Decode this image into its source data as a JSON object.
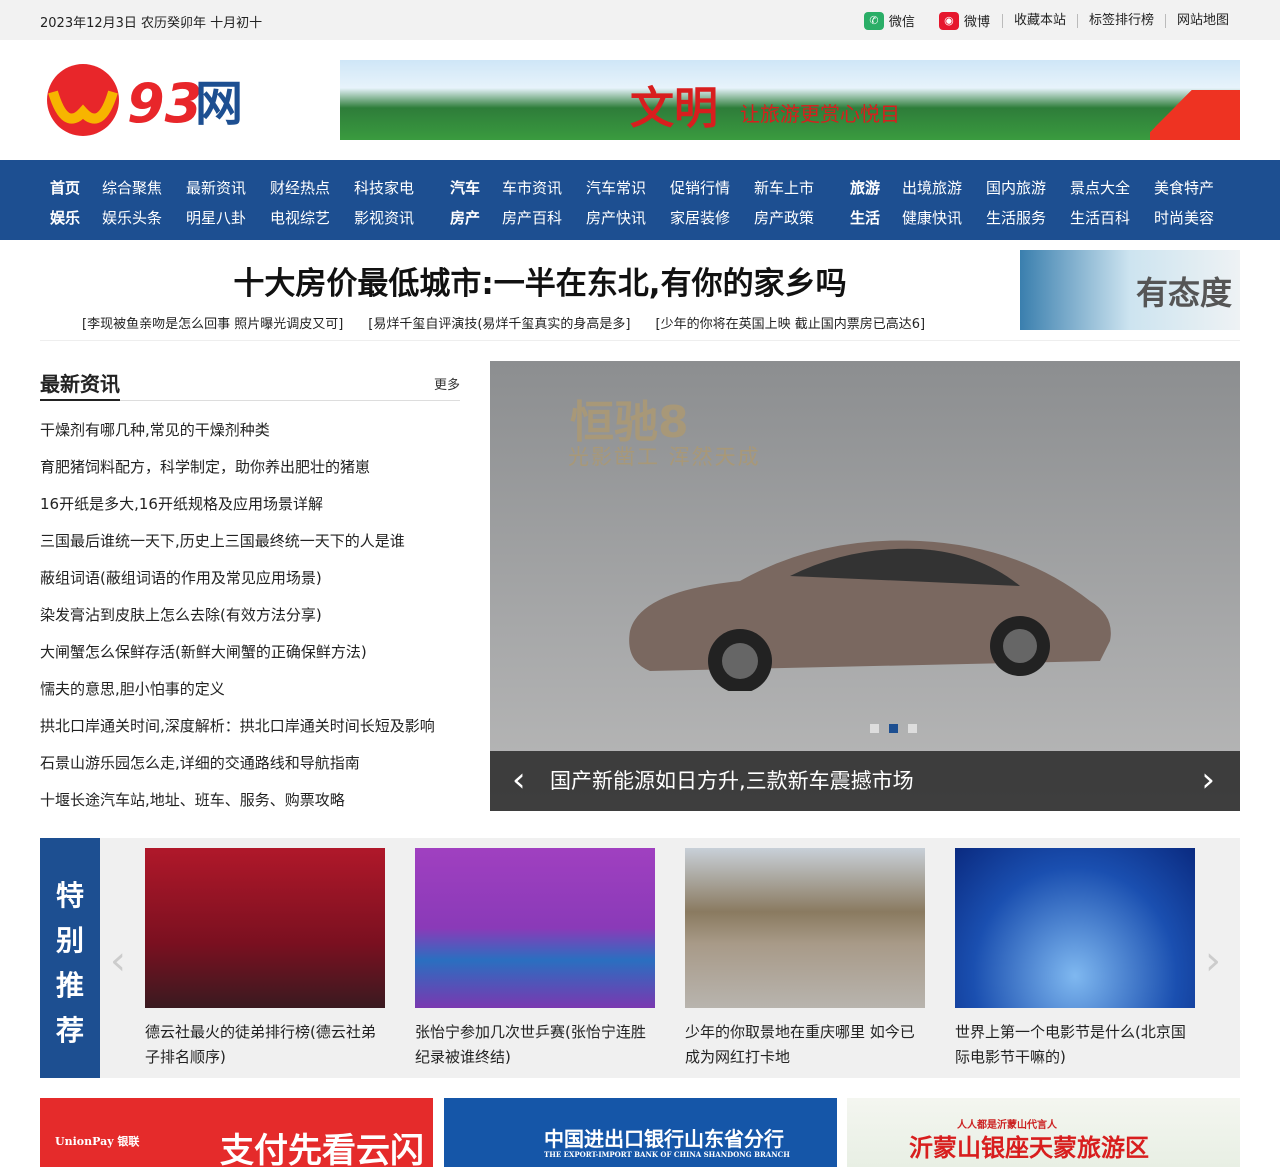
{
  "topbar": {
    "date": "2023年12月3日 农历癸卯年 十月初十",
    "wechat": "微信",
    "weibo": "微博",
    "links": [
      "收藏本站",
      "标签排行榜",
      "网站地图"
    ]
  },
  "logo": {
    "text": "93网"
  },
  "banner": {
    "title": "文明",
    "subtitle": "让旅游更赏心悦目"
  },
  "nav": {
    "row1": [
      {
        "g": "首页",
        "items": [
          "综合聚焦",
          "最新资讯",
          "财经热点",
          "科技家电"
        ]
      },
      {
        "g": "汽车",
        "items": [
          "车市资讯",
          "汽车常识",
          "促销行情",
          "新车上市"
        ]
      },
      {
        "g": "旅游",
        "items": [
          "出境旅游",
          "国内旅游",
          "景点大全",
          "美食特产"
        ]
      }
    ],
    "row2": [
      {
        "g": "娱乐",
        "items": [
          "娱乐头条",
          "明星八卦",
          "电视综艺",
          "影视资讯"
        ]
      },
      {
        "g": "房产",
        "items": [
          "房产百科",
          "房产快讯",
          "家居装修",
          "房产政策"
        ]
      },
      {
        "g": "生活",
        "items": [
          "健康快讯",
          "生活服务",
          "生活百科",
          "时尚美容"
        ]
      }
    ]
  },
  "headline": {
    "title": "十大房价最低城市:一半在东北,有你的家乡吗",
    "sublinks": [
      "[李现被鱼亲吻是怎么回事 照片曝光调皮又可]",
      "[易烊千玺自评演技(易烊千玺真实的身高是多]",
      "[少年的你将在英国上映 截止国内票房已高达6]"
    ],
    "side_image_text": "有态度"
  },
  "news": {
    "title": "最新资讯",
    "more": "更多",
    "items": [
      "干燥剂有哪几种,常见的干燥剂种类",
      "育肥猪饲料配方，科学制定，助你养出肥壮的猪崽",
      "16开纸是多大,16开纸规格及应用场景详解",
      "三国最后谁统一天下,历史上三国最终统一天下的人是谁",
      "蔽组词语(蔽组词语的作用及常见应用场景)",
      "染发膏沾到皮肤上怎么去除(有效方法分享)",
      "大闸蟹怎么保鲜存活(新鲜大闸蟹的正确保鲜方法)",
      "懦夫的意思,胆小怕事的定义",
      "拱北口岸通关时间,深度解析：拱北口岸通关时间长短及影响",
      "石景山游乐园怎么走,详细的交通路线和导航指南",
      "十堰长途汽车站,地址、班车、服务、购票攻略"
    ]
  },
  "slider": {
    "brand": "恒驰8",
    "tagline": "光影凿工 浑然天成",
    "caption": "国产新能源如日方升,三款新车震撼市场",
    "active_dot": 2,
    "dot_count": 3
  },
  "featured": {
    "label": [
      "特",
      "别",
      "推",
      "荐"
    ],
    "cards": [
      "德云社最火的徒弟排行榜(德云社弟子排名顺序)",
      "张怡宁参加几次世乒赛(张怡宁连胜纪录被谁终结)",
      "少年的你取景地在重庆哪里 如今已成为网红打卡地",
      "世界上第一个电影节是什么(北京国际电影节干嘛的)"
    ]
  },
  "ads": [
    {
      "text": "支付先看云闪付",
      "sub": "UnionPay 银联"
    },
    {
      "text": "中国进出口银行山东省分行",
      "sub": "THE EXPORT-IMPORT BANK OF CHINA SHANDONG BRANCH"
    },
    {
      "text": "沂蒙山银座天蒙旅游区",
      "sub": "人人都是沂蒙山代言人"
    }
  ]
}
